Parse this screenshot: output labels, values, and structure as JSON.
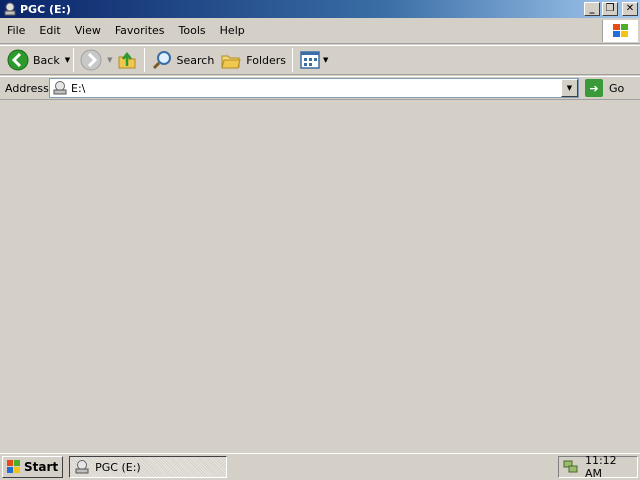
{
  "window": {
    "title": "PGC (E:)"
  },
  "menu": {
    "items": [
      "File",
      "Edit",
      "View",
      "Favorites",
      "Tools",
      "Help"
    ]
  },
  "toolbar": {
    "back_label": "Back",
    "search_label": "Search",
    "folders_label": "Folders"
  },
  "address": {
    "label": "Address",
    "value": "E:\\",
    "go_label": "Go"
  },
  "taskbar": {
    "start_label": "Start",
    "task_label": "PGC (E:)",
    "clock": "11:12 AM"
  },
  "icons": {
    "title": "drive-icon",
    "back": "back-arrow-icon",
    "forward": "forward-arrow-icon",
    "up": "up-folder-icon",
    "search": "search-icon",
    "folders": "folders-icon",
    "views": "views-icon",
    "go": "go-arrow-icon",
    "start": "windows-flag-icon",
    "network": "network-icon"
  },
  "colors": {
    "titlebar_start": "#0a246a",
    "titlebar_end": "#a6caf0",
    "chrome": "#d4d0c8",
    "go_green": "#3a9a3a",
    "back_green": "#2e9a2e"
  }
}
